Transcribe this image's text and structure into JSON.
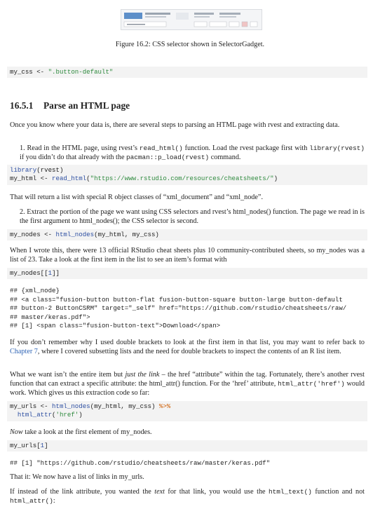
{
  "figure": {
    "caption": "Figure 16.2: CSS selector shown in SelectorGadget."
  },
  "code1": {
    "var": "my_css",
    "assign": " <- ",
    "str": "\".button-default\""
  },
  "section": {
    "number": "16.5.1",
    "title": "Parse an HTML page"
  },
  "p_intro": "Once you know where your data is, there are several steps to parsing an HTML page with rvest and extracting data.",
  "step1": {
    "num": "1.",
    "a": " Read in the HTML page, using rvest’s ",
    "code_a": "read_html()",
    "b": " function. Load the rvest package first with ",
    "code_b": "library(rvest)",
    "c": " if you didn’t do that already with the ",
    "code_c": "pacman::p_load(rvest)",
    "d": " command."
  },
  "code2": {
    "l1_fn": "library",
    "l1_rest": "(rvest)",
    "l2_var": "my_html",
    "l2_assign": " <- ",
    "l2_fn": "read_html",
    "l2_open": "(",
    "l2_str": "\"https://www.rstudio.com/resources/cheatsheets/\"",
    "l2_close": ")"
  },
  "p_return": "That will return a list with special R object classes of “xml_document” and “xml_node”.",
  "step2": {
    "num": "2.",
    "text": " Extract the portion of the page we want using CSS selectors and rvest’s html_nodes() function. The page we read in is the first argument to html_nodes(); the CSS selector is second."
  },
  "code3": {
    "var": "my_nodes",
    "assign": " <- ",
    "fn": "html_nodes",
    "args": "(my_html, my_css)"
  },
  "p_wrote": "When I wrote this, there were 13 official RStudio cheat sheets plus 10 community-contributed sheets, so my_nodes was a list of 23. Take a look at the first item in the list to see an item’s format with",
  "code4": {
    "var": "my_nodes",
    "open": "[[",
    "num": "1",
    "close": "]]"
  },
  "out1": [
    "## {xml_node}",
    "## <a class=\"fusion-button button-flat fusion-button-square button-large button-default",
    "## button-2 ButtonCSRM\" target=\"_self\" href=\"https://github.com/rstudio/cheatsheets/raw/",
    "## master/keras.pdf\">",
    "## [1] <span class=\"fusion-button-text\">Download</span>"
  ],
  "p_brackets": {
    "a": "If you don’t remember why I used double brackets to look at the first item in that list, you may want to refer back to ",
    "link": "Chapter 7",
    "b": ", where I covered subsetting lists and the need for double brackets to inspect the contents of an R list item."
  },
  "p_what": {
    "a": "What we want isn’t the entire item but ",
    "em": "just the link",
    "b": " – the href “attribute” within the tag. Fortunately, there’s another rvest function that can extract a specific attribute: the html_attr() function. For the ‘href’ attribute, ",
    "code": "html_attr('href')",
    "c": " would work. Which gives us this extraction code so far:"
  },
  "code5": {
    "l1_var": "my_urls",
    "l1_assign": " <- ",
    "l1_fn": "html_nodes",
    "l1_args": "(my_html, my_css) ",
    "l1_pipe": "%>%",
    "l2_fn": "html_attr",
    "l2_open": "(",
    "l2_str": "'href'",
    "l2_close": ")"
  },
  "p_now": {
    "em": "Now",
    "rest": " take a look at the first element of my_nodes."
  },
  "code6": {
    "var": "my_urls",
    "open": "[",
    "num": "1",
    "close": "]"
  },
  "out2": "## [1] \"https://github.com/rstudio/cheatsheets/raw/master/keras.pdf\"",
  "p_thatit": "That it: We now have a list of links in my_urls.",
  "p_instead": {
    "a": "If instead of the link attribute, you wanted the ",
    "em": "text",
    "b": " for that link, you would use the ",
    "code1": "html_text()",
    "c": " function and not ",
    "code2": "html_attr()",
    "d": ":"
  }
}
